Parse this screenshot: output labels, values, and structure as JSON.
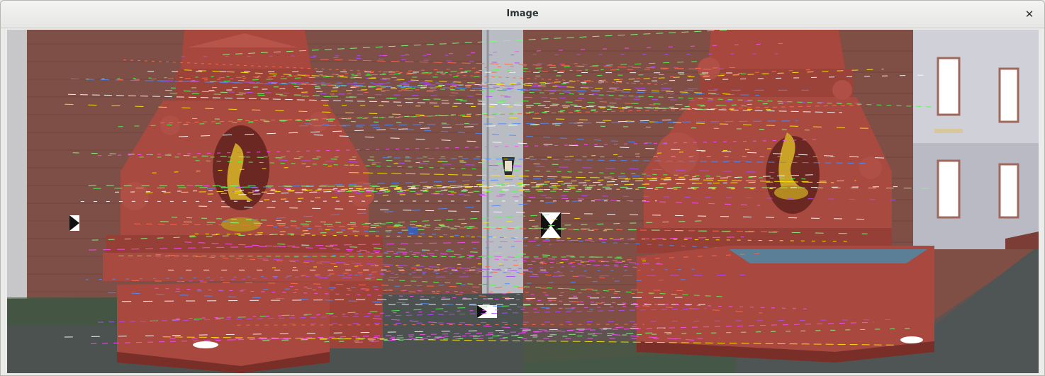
{
  "window": {
    "title": "Image",
    "close_icon": "close-icon",
    "close_glyph": "✕"
  },
  "colors": {
    "wall": "#8a544a",
    "sandstone": "#a34a40",
    "fountain_dark": "#7a2e28",
    "gold": "#c9a227",
    "ground": "#4d5250",
    "building": "#c9c9d2",
    "water": "#5a7f97",
    "match_lines": [
      "#ffea00",
      "#4cff4c",
      "#ff4cff",
      "#4c8cff",
      "#ffffff",
      "#ff6a4c",
      "#7fff7f",
      "#b04cff"
    ]
  }
}
